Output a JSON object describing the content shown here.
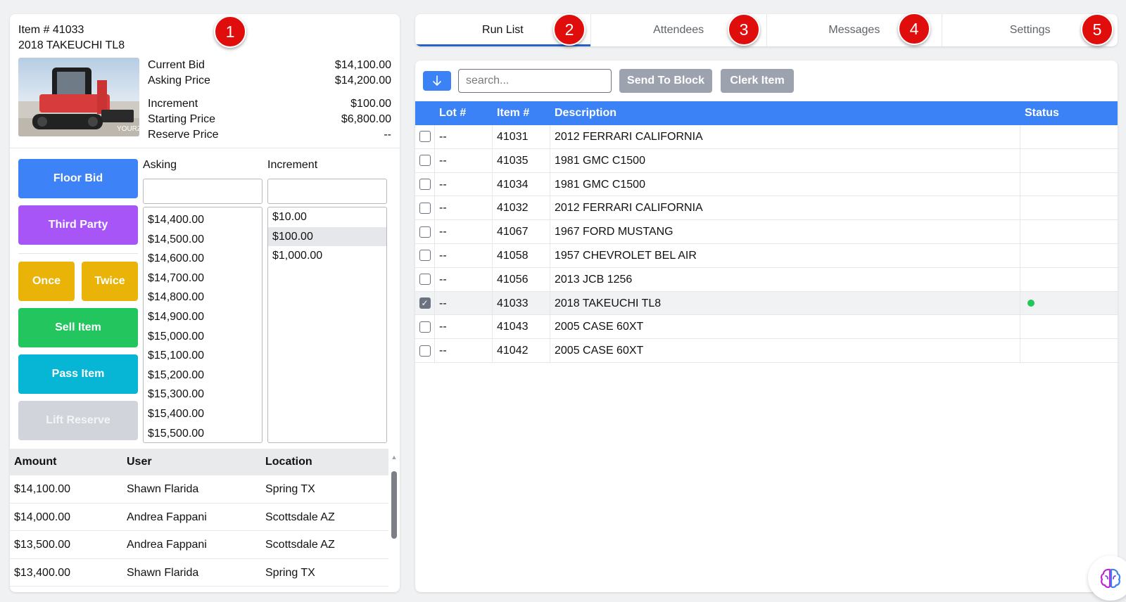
{
  "item": {
    "number": "Item # 41033",
    "title": "2018 TAKEUCHI TL8",
    "photo_watermark": "YOURZ"
  },
  "prices": [
    {
      "label": "Current Bid",
      "value": "$14,100.00"
    },
    {
      "label": "Asking Price",
      "value": "$14,200.00"
    },
    {
      "label": "Increment",
      "value": "$100.00"
    },
    {
      "label": "Starting Price",
      "value": "$6,800.00"
    },
    {
      "label": "Reserve Price",
      "value": "--"
    }
  ],
  "actions": {
    "floor_bid": "Floor Bid",
    "third_party": "Third Party",
    "once": "Once",
    "twice": "Twice",
    "sell_item": "Sell Item",
    "pass_item": "Pass Item",
    "lift_reserve": "Lift Reserve"
  },
  "asking": {
    "label": "Asking",
    "input_value": "",
    "options": [
      "$14,400.00",
      "$14,500.00",
      "$14,600.00",
      "$14,700.00",
      "$14,800.00",
      "$14,900.00",
      "$15,000.00",
      "$15,100.00",
      "$15,200.00",
      "$15,300.00",
      "$15,400.00",
      "$15,500.00"
    ]
  },
  "increment": {
    "label": "Increment",
    "input_value": "",
    "options": [
      "$10.00",
      "$100.00",
      "$1,000.00"
    ],
    "selected": "$100.00"
  },
  "bids": {
    "headers": [
      "Amount",
      "User",
      "Location"
    ],
    "rows": [
      [
        "$14,100.00",
        "Shawn Flarida",
        "Spring TX"
      ],
      [
        "$14,000.00",
        "Andrea Fappani",
        "Scottsdale AZ"
      ],
      [
        "$13,500.00",
        "Andrea Fappani",
        "Scottsdale AZ"
      ],
      [
        "$13,400.00",
        "Shawn Flarida",
        "Spring TX"
      ]
    ]
  },
  "tabs": [
    "Run List",
    "Attendees",
    "Messages",
    "Settings"
  ],
  "active_tab": "Run List",
  "badges": [
    "1",
    "2",
    "3",
    "4",
    "5"
  ],
  "toolbar": {
    "search_placeholder": "search...",
    "send_to_block": "Send To Block",
    "clerk_item": "Clerk Item"
  },
  "run_list": {
    "headers": [
      "Lot #",
      "Item #",
      "Description",
      "Status"
    ],
    "rows": [
      {
        "lot": "--",
        "item": "41031",
        "description": "2012 FERRARI CALIFORNIA",
        "checked": false,
        "active": false
      },
      {
        "lot": "--",
        "item": "41035",
        "description": "1981 GMC C1500",
        "checked": false,
        "active": false
      },
      {
        "lot": "--",
        "item": "41034",
        "description": "1981 GMC C1500",
        "checked": false,
        "active": false
      },
      {
        "lot": "--",
        "item": "41032",
        "description": "2012 FERRARI CALIFORNIA",
        "checked": false,
        "active": false
      },
      {
        "lot": "--",
        "item": "41067",
        "description": "1967 FORD MUSTANG",
        "checked": false,
        "active": false
      },
      {
        "lot": "--",
        "item": "41058",
        "description": "1957 CHEVROLET BEL AIR",
        "checked": false,
        "active": false
      },
      {
        "lot": "--",
        "item": "41056",
        "description": "2013 JCB 1256",
        "checked": false,
        "active": false
      },
      {
        "lot": "--",
        "item": "41033",
        "description": "2018 TAKEUCHI TL8",
        "checked": true,
        "active": true
      },
      {
        "lot": "--",
        "item": "41043",
        "description": "2005 CASE 60XT",
        "checked": false,
        "active": false
      },
      {
        "lot": "--",
        "item": "41042",
        "description": "2005 CASE 60XT",
        "checked": false,
        "active": false
      }
    ]
  },
  "colors": {
    "accent_blue": "#3b82f6",
    "tab_underline": "#2563c9",
    "badge_red": "#e00d0d",
    "status_active": "#22c55e",
    "third_party": "#a855f7",
    "once_twice": "#eab308",
    "sell": "#22c55e",
    "pass": "#06b6d4",
    "disabled": "#d1d5db"
  },
  "icons": {
    "sort": "arrow-down-icon",
    "assistant": "brain-icon"
  }
}
